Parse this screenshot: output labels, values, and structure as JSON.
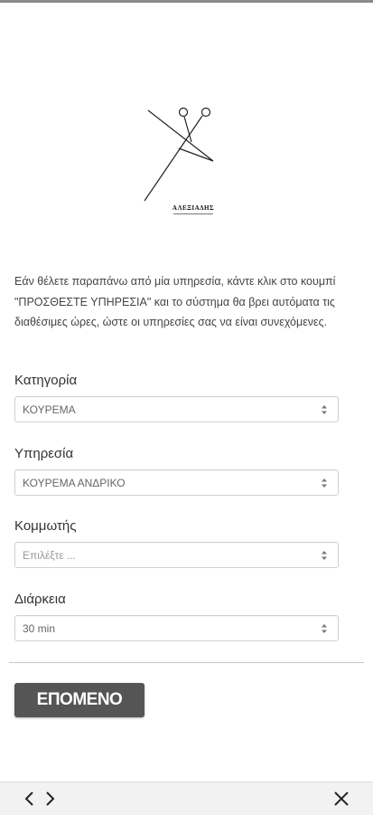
{
  "brand": {
    "logo_text": "ΑΛΕΞΙΑΔΗΣ"
  },
  "intro_text": "Εάν θέλετε παραπάνω από μία υπηρεσία, κάντε κλικ στο κουμπί \"ΠΡΟΣΘΕΣΤΕ ΥΠΗΡΕΣΙΑ\" και το σύστημα θα βρει αυτόματα τις διαθέσιμες ώρες, ώστε οι υπηρεσίες σας να είναι συνεχόμενες.",
  "form": {
    "category": {
      "label": "Κατηγορία",
      "value": "ΚΟΥΡΕΜΑ"
    },
    "service": {
      "label": "Υπηρεσία",
      "value": "ΚΟΥΡΕΜΑ ΑΝΔΡΙΚΟ"
    },
    "stylist": {
      "label": "Κομμωτής",
      "placeholder": "Επιλέξτε ..."
    },
    "duration": {
      "label": "Διάρκεια",
      "value": "30 min"
    }
  },
  "next_button_label": "ΕΠΟΜΕΝΟ",
  "icons": {
    "back": "chevron-left-icon",
    "forward": "chevron-right-icon",
    "close": "close-icon",
    "select": "select-arrows-icon"
  },
  "colors": {
    "button_bg": "#555555",
    "button_text": "#ffffff"
  }
}
